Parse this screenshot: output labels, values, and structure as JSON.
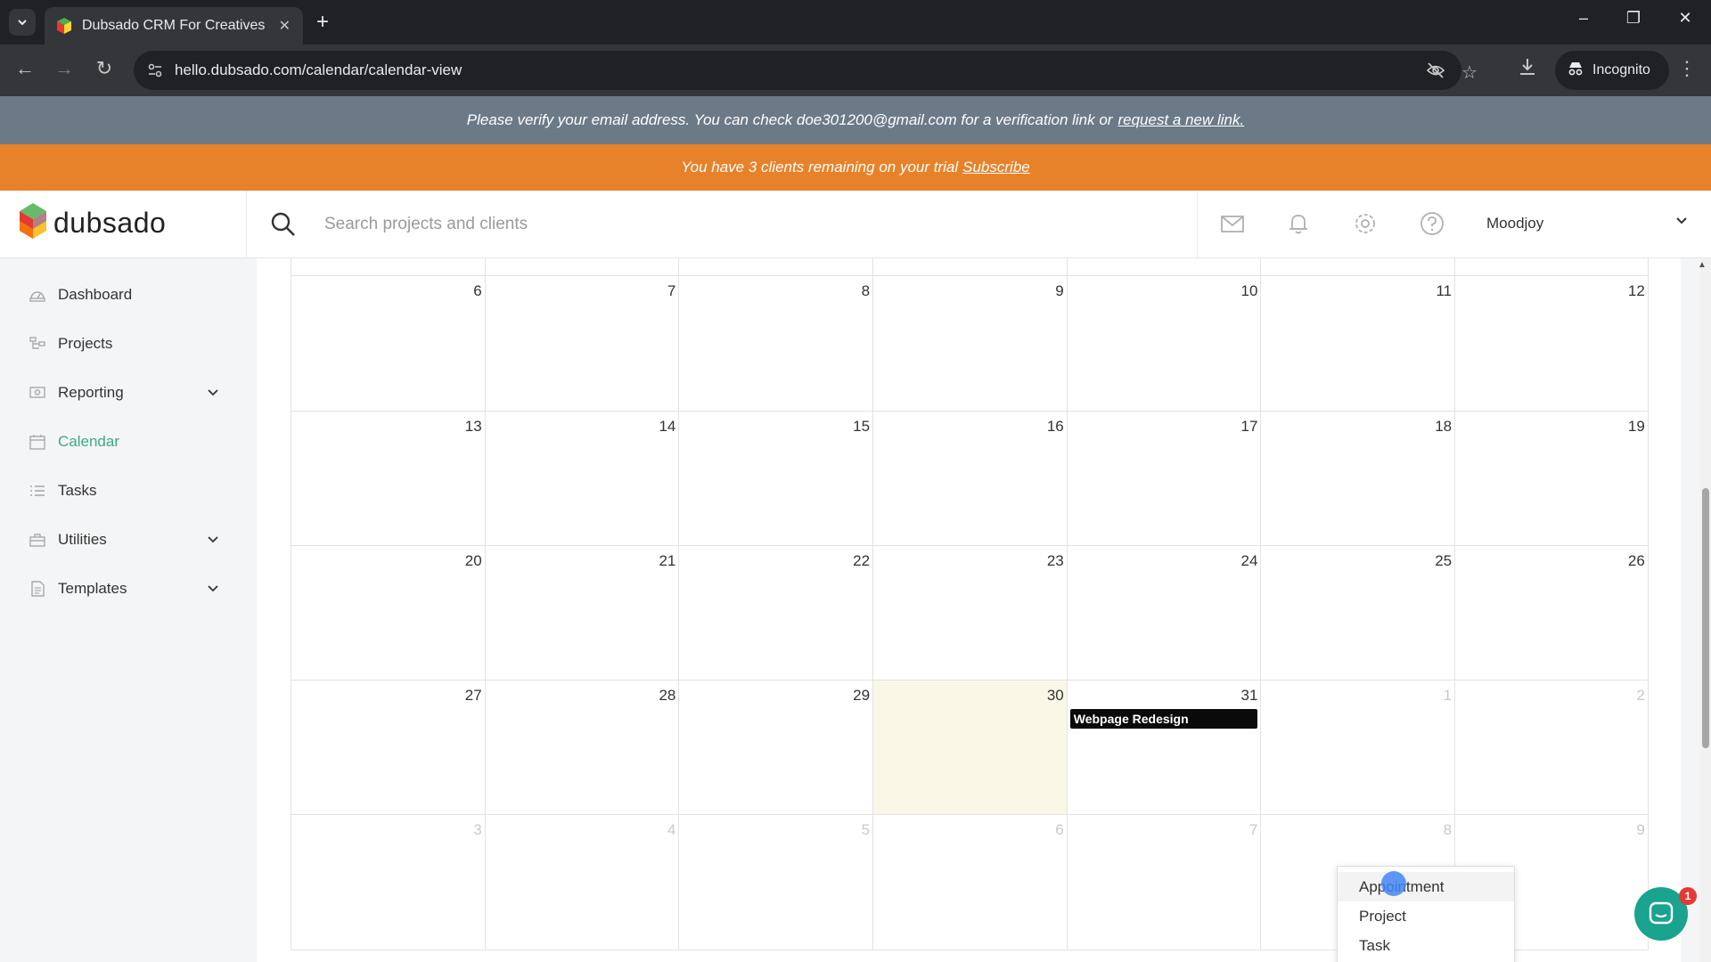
{
  "browser": {
    "tab_title": "Dubsado CRM For Creatives",
    "url": "hello.dubsado.com/calendar/calendar-view",
    "incognito_label": "Incognito"
  },
  "banners": {
    "verify_text": "Please verify your email address. You can check doe301200@gmail.com for a verification link or",
    "verify_link": "request a new link.",
    "trial_text": "You have 3 clients remaining on your trial",
    "trial_link": "Subscribe"
  },
  "header": {
    "logo_text": "dubsado",
    "search_placeholder": "Search projects and clients",
    "user_name": "Moodjoy"
  },
  "sidebar": {
    "items": [
      {
        "label": "Dashboard",
        "icon": "dashboard-icon"
      },
      {
        "label": "Projects",
        "icon": "projects-icon"
      },
      {
        "label": "Reporting",
        "icon": "reporting-icon",
        "expandable": true
      },
      {
        "label": "Calendar",
        "icon": "calendar-icon",
        "active": true
      },
      {
        "label": "Tasks",
        "icon": "tasks-icon"
      },
      {
        "label": "Utilities",
        "icon": "utilities-icon",
        "expandable": true
      },
      {
        "label": "Templates",
        "icon": "templates-icon",
        "expandable": true
      }
    ]
  },
  "calendar": {
    "weeks": [
      [
        "6",
        "7",
        "8",
        "9",
        "10",
        "11",
        "12"
      ],
      [
        "13",
        "14",
        "15",
        "16",
        "17",
        "18",
        "19"
      ],
      [
        "20",
        "21",
        "22",
        "23",
        "24",
        "25",
        "26"
      ],
      [
        "27",
        "28",
        "29",
        "30",
        "31",
        "1",
        "2"
      ],
      [
        "3",
        "4",
        "5",
        "6",
        "7",
        "8",
        "9"
      ]
    ],
    "today_label": "30",
    "event": {
      "title": "Webpage Redesign",
      "day": "31"
    }
  },
  "dropdown": {
    "items": [
      "Appointment",
      "Project",
      "Task"
    ]
  },
  "chat": {
    "badge_count": "1"
  },
  "colors": {
    "accent": "#3fa98a",
    "trial_banner": "#e8822a",
    "verify_banner": "#6c7a87",
    "today_bg": "#f9f7e6",
    "event_bg": "#0a0a0a",
    "chat": "#1aa38f"
  }
}
